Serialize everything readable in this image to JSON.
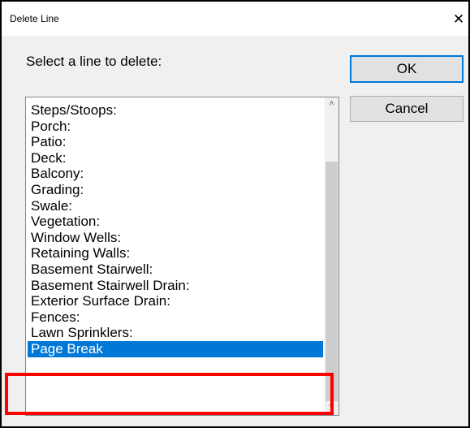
{
  "window": {
    "title": "Delete Line",
    "close_glyph": "✕"
  },
  "prompt": {
    "label": "Select a line to delete:"
  },
  "buttons": {
    "ok_label": "OK",
    "cancel_label": "Cancel"
  },
  "list": {
    "items": [
      {
        "label": "Steps/Stoops:"
      },
      {
        "label": "Porch:"
      },
      {
        "label": "Patio:"
      },
      {
        "label": "Deck:"
      },
      {
        "label": "Balcony:"
      },
      {
        "label": "Grading:"
      },
      {
        "label": "Swale:"
      },
      {
        "label": "Vegetation:"
      },
      {
        "label": "Window Wells:"
      },
      {
        "label": "Retaining Walls:"
      },
      {
        "label": "Basement Stairwell:"
      },
      {
        "label": "Basement Stairwell Drain:"
      },
      {
        "label": "Exterior Surface Drain:"
      },
      {
        "label": "Fences:"
      },
      {
        "label": "Lawn Sprinklers:"
      },
      {
        "label": "Page Break"
      }
    ],
    "selected_label": "Page Break"
  },
  "scrollbar": {
    "up_glyph": "˄",
    "down_glyph": "˅"
  },
  "colors": {
    "selection": "#0078d7",
    "annotation": "#ff0000",
    "dialog_background": "#f0f0f0"
  }
}
